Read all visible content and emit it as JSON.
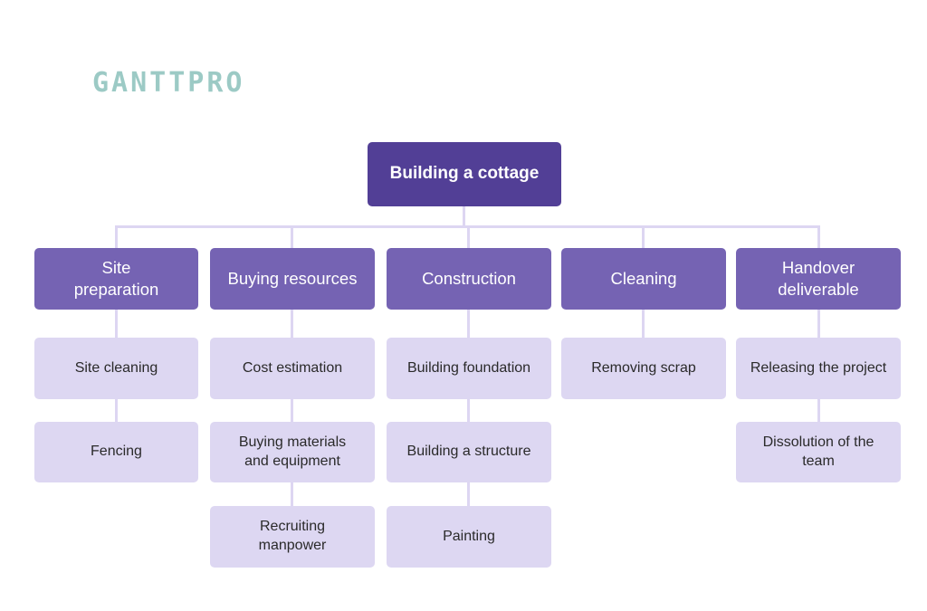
{
  "logo": {
    "text": "GANTTPRO",
    "color": "#9ccac5"
  },
  "colors": {
    "root": "#523f96",
    "category": "#7563b3",
    "task": "#ddd7f2",
    "connector": "#ddd6f2"
  },
  "root": {
    "label": "Building a cottage"
  },
  "categories": [
    {
      "label": "Site preparation",
      "tasks": [
        {
          "label": "Site cleaning"
        },
        {
          "label": "Fencing"
        }
      ]
    },
    {
      "label": "Buying resources",
      "tasks": [
        {
          "label": "Cost estimation"
        },
        {
          "label": "Buying materials and equipment"
        },
        {
          "label": "Recruiting manpower"
        }
      ]
    },
    {
      "label": "Construction",
      "tasks": [
        {
          "label": "Building foundation"
        },
        {
          "label": "Building a structure"
        },
        {
          "label": "Painting"
        }
      ]
    },
    {
      "label": "Cleaning",
      "tasks": [
        {
          "label": "Removing scrap"
        }
      ]
    },
    {
      "label": "Handover deliverable",
      "tasks": [
        {
          "label": "Releasing the project"
        },
        {
          "label": "Dissolution of the team"
        }
      ]
    }
  ]
}
